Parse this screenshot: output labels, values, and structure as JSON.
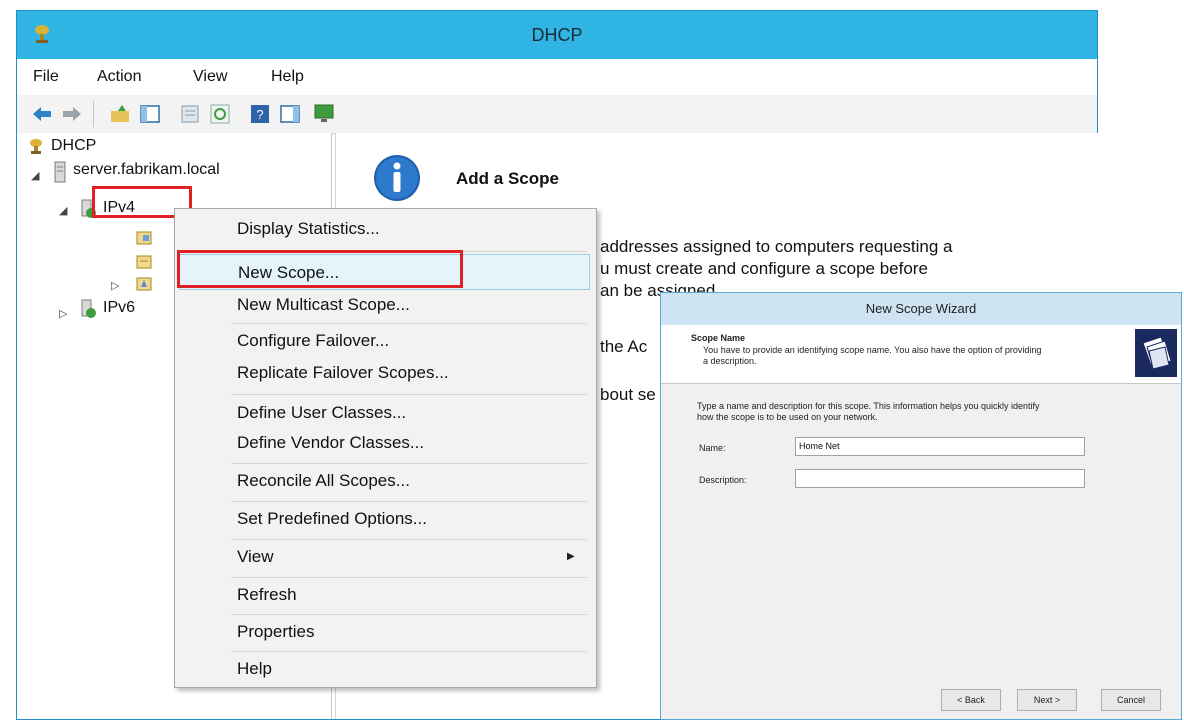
{
  "window": {
    "title": "DHCP"
  },
  "menu": {
    "items": [
      "File",
      "Action",
      "View",
      "Help"
    ]
  },
  "toolbar": {
    "buttons": [
      "back-arrow-icon",
      "forward-arrow-icon",
      "up-folder-icon",
      "show-hide-console-tree-icon",
      "properties-icon",
      "refresh-icon",
      "help-icon",
      "show-action-pane-icon",
      "monitor-icon"
    ]
  },
  "tree": {
    "root": "DHCP",
    "server": "server.fabrikam.local",
    "ipv4": "IPv4",
    "ipv6": "IPv6"
  },
  "details": {
    "heading": "Add a Scope",
    "lines": [
      "addresses assigned to computers requesting a",
      "u must create and configure a scope before",
      "an be assigned.",
      "the Ac",
      "bout se"
    ]
  },
  "context_menu": {
    "items": [
      {
        "label": "Display Statistics...",
        "highlighted": false
      },
      {
        "label": "New Scope...",
        "highlighted": true
      },
      {
        "label": "New Multicast Scope...",
        "highlighted": false
      },
      {
        "label": "Configure Failover...",
        "highlighted": false
      },
      {
        "label": "Replicate Failover Scopes...",
        "highlighted": false
      },
      {
        "label": "Define User Classes...",
        "highlighted": false
      },
      {
        "label": "Define Vendor Classes...",
        "highlighted": false
      },
      {
        "label": "Reconcile All Scopes...",
        "highlighted": false
      },
      {
        "label": "Set Predefined Options...",
        "highlighted": false
      },
      {
        "label": "View",
        "highlighted": false,
        "submenu": true
      },
      {
        "label": "Refresh",
        "highlighted": false
      },
      {
        "label": "Properties",
        "highlighted": false
      },
      {
        "label": "Help",
        "highlighted": false
      }
    ]
  },
  "wizard": {
    "title": "New Scope Wizard",
    "header_title": "Scope Name",
    "header_line1": "You have to provide an identifying scope name. You also have the option of providing",
    "header_line2": "a description.",
    "body_line1": "Type a name and description for this scope. This information helps you quickly identify",
    "body_line2": "how the scope is to be used on your network.",
    "name_label": "Name:",
    "name_value": "Home Net",
    "description_label": "Description:",
    "description_value": "",
    "back_label": "< Back",
    "next_label": "Next >",
    "cancel_label": "Cancel"
  },
  "colors": {
    "titlebar": "#2fb4e3",
    "highlight_border": "#e01f26",
    "menu_hover": "#e5f3fb"
  }
}
